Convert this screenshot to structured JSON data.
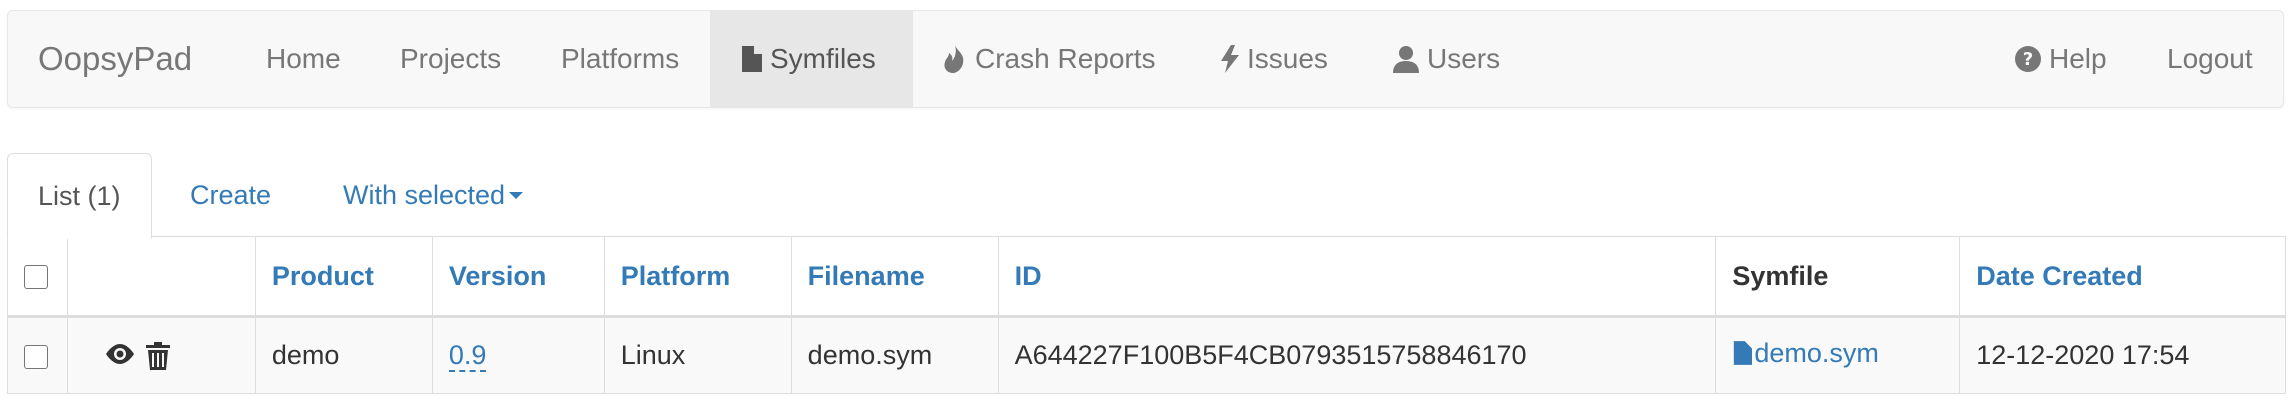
{
  "navbar": {
    "brand": "OopsyPad",
    "items": [
      {
        "label": "Home",
        "icon": ""
      },
      {
        "label": "Projects",
        "icon": ""
      },
      {
        "label": "Platforms",
        "icon": ""
      },
      {
        "label": "Symfiles",
        "icon": "file-icon",
        "active": true
      },
      {
        "label": "Crash Reports",
        "icon": "fire-icon"
      },
      {
        "label": "Issues",
        "icon": "flash-icon"
      },
      {
        "label": "Users",
        "icon": "user-icon"
      }
    ],
    "right_items": [
      {
        "label": "Help",
        "icon": "question-circle-icon"
      },
      {
        "label": "Logout",
        "icon": ""
      }
    ]
  },
  "tabs": [
    {
      "label": "List (1)",
      "active": true
    },
    {
      "label": "Create"
    },
    {
      "label": "With selected",
      "dropdown": true
    }
  ],
  "table": {
    "columns": [
      "",
      "",
      "Product",
      "Version",
      "Platform",
      "Filename",
      "ID",
      "Symfile",
      "Date Created"
    ],
    "rows": [
      {
        "product": "demo",
        "version": "0.9",
        "platform": "Linux",
        "filename": "demo.sym",
        "id": "A644227F100B5F4CB0793515758846170",
        "symfile": "demo.sym",
        "date_created": "12-12-2020 17:54"
      }
    ]
  },
  "colors": {
    "link": "#337ab7",
    "navbar_bg": "#f8f8f8",
    "active_nav_bg": "#e7e7e7"
  }
}
